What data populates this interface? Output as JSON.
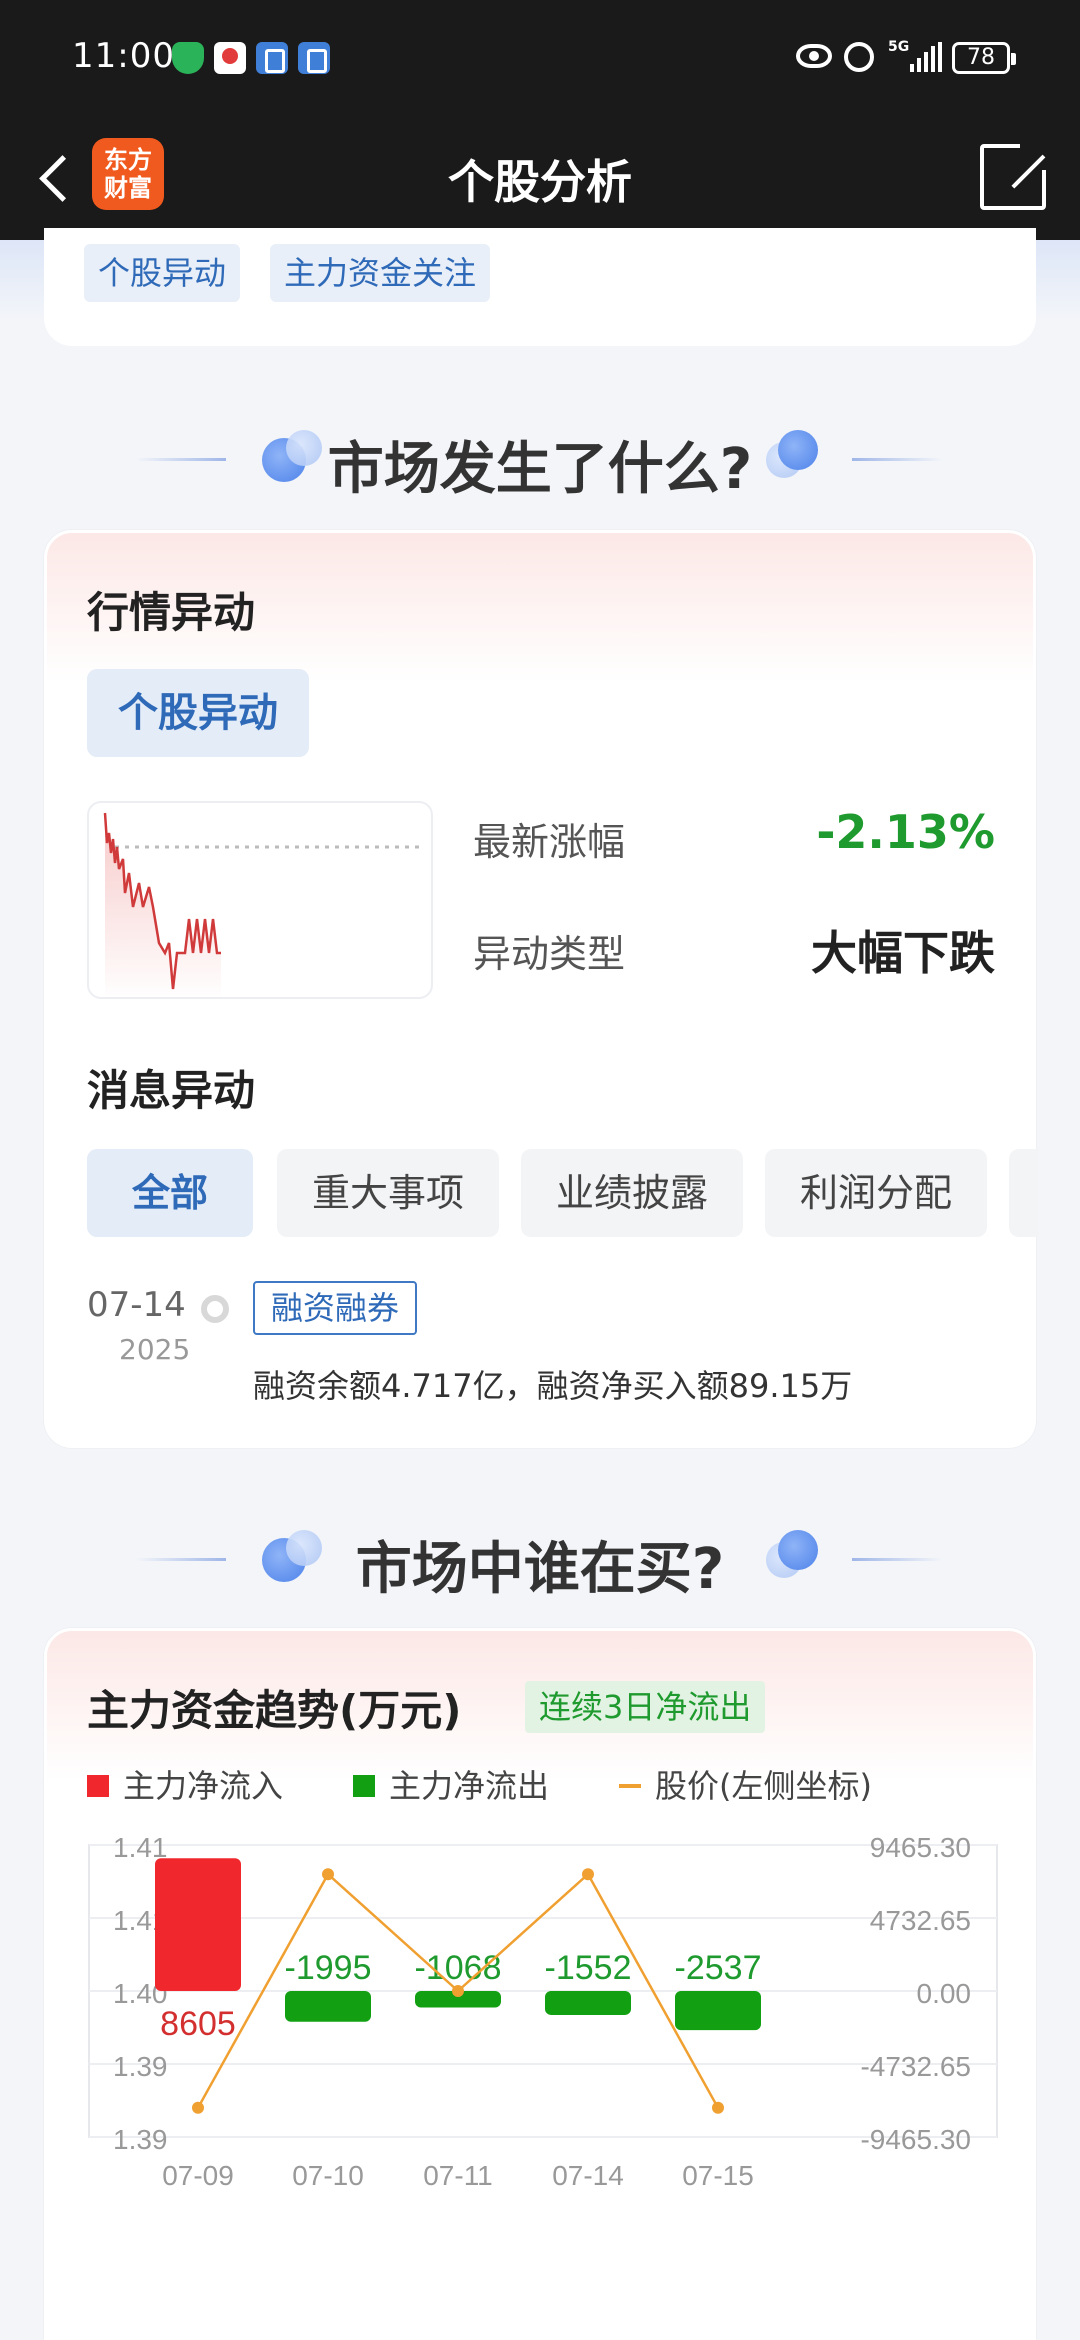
{
  "status_bar": {
    "time": "11:00",
    "network": "5G",
    "battery": "78"
  },
  "header": {
    "title": "个股分析",
    "logo_line1": "东方",
    "logo_line2": "财富"
  },
  "top_tags": [
    "个股异动",
    "主力资金关注"
  ],
  "section1": {
    "title": "市场发生了什么?"
  },
  "market_card": {
    "heading": "行情异动",
    "chip": "个股异动",
    "latest_change_label": "最新涨幅",
    "latest_change_value": "-2.13%",
    "anomaly_type_label": "异动类型",
    "anomaly_type_value": "大幅下跌",
    "news_heading": "消息异动",
    "filters": [
      "全部",
      "重大事项",
      "业绩披露",
      "利润分配"
    ],
    "news": {
      "date": "07-14",
      "year": "2025",
      "tag": "融资融券",
      "text": "融资余额4.717亿，融资净买入额89.15万"
    }
  },
  "section2": {
    "title": "市场中谁在买?"
  },
  "fund_card": {
    "heading": "主力资金趋势(万元)",
    "badge": "连续3日净流出",
    "legend": [
      "主力净流入",
      "主力净流出",
      "股价(左侧坐标)"
    ],
    "colors": {
      "inflow": "#f0282d",
      "outflow": "#12a012",
      "price": "#f0a030",
      "change_down": "#1e9a2e"
    }
  },
  "chart_data": {
    "type": "bar",
    "categories": [
      "07-09",
      "07-10",
      "07-11",
      "07-14",
      "07-15"
    ],
    "series": [
      {
        "name": "主力净流入",
        "values": [
          8605,
          -1995,
          -1068,
          -1552,
          -2537
        ]
      },
      {
        "name": "股价(左侧坐标)",
        "values": [
          1.392,
          1.408,
          1.4,
          1.408,
          1.392
        ]
      }
    ],
    "bar_labels": [
      "8605",
      "-1995",
      "-1068",
      "-1552",
      "-2537"
    ],
    "left_ticks": [
      "1.41",
      "1.41",
      "1.40",
      "1.39",
      "1.39"
    ],
    "right_ticks": [
      "9465.30",
      "4732.65",
      "0.00",
      "-4732.65",
      "-9465.30"
    ],
    "ylim_right": [
      -9465.3,
      9465.3
    ],
    "ylim_left": [
      1.39,
      1.41
    ]
  }
}
